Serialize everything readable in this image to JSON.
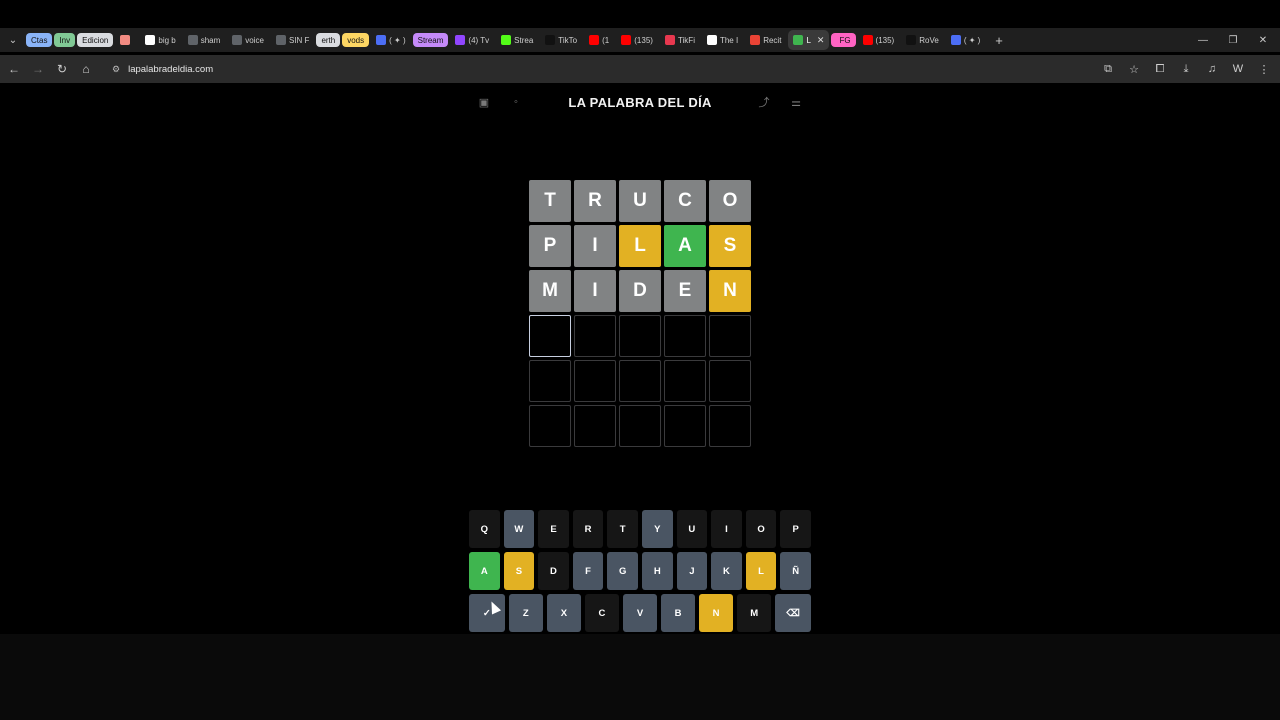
{
  "browser": {
    "tab_groups": [
      {
        "label": "Ctas",
        "color": "#8ab4f8"
      },
      {
        "label": "Inv",
        "color": "#81c995"
      },
      {
        "label": "Edicion",
        "color": "#dadce0"
      }
    ],
    "tabs": [
      {
        "label": "",
        "fav_color": "#f28b82"
      },
      {
        "label": "big b",
        "fav_color": "#ffffff"
      },
      {
        "label": "sham",
        "fav_color": "#5f6368"
      },
      {
        "label": "voice",
        "fav_color": "#5f6368"
      },
      {
        "label": "SIN F",
        "fav_color": "#5f6368"
      }
    ],
    "group2": [
      {
        "label": "erth",
        "color": "#dadce0"
      },
      {
        "label": "vods",
        "color": "#fdd663"
      }
    ],
    "tabs2": [
      {
        "label": "( ✦ )",
        "fav_color": "#4c6ef5"
      }
    ],
    "stream_group": {
      "label": "Stream",
      "color": "#c58af9"
    },
    "tabs3": [
      {
        "label": "(4) Tv",
        "fav_color": "#9146ff"
      },
      {
        "label": "Strea",
        "fav_color": "#53fc18"
      },
      {
        "label": "TikTo",
        "fav_color": "#111111"
      },
      {
        "label": "(1",
        "fav_color": "#ff0000"
      },
      {
        "label": "(135)",
        "fav_color": "#ff0000"
      },
      {
        "label": "TikFi",
        "fav_color": "#e8384f"
      },
      {
        "label": "The I",
        "fav_color": "#ffffff"
      },
      {
        "label": "Recit",
        "fav_color": "#ea4335"
      },
      {
        "label": "L",
        "fav_color": "#3fb54f",
        "active": true
      },
      {
        "label": "FG",
        "fav_color": "#ff63c3",
        "group": true
      },
      {
        "label": "(135)",
        "fav_color": "#ff0000"
      },
      {
        "label": "RoVe",
        "fav_color": "#111111"
      },
      {
        "label": "( ✦ )",
        "fav_color": "#4c6ef5"
      }
    ],
    "url": "lapalabradeldia.com"
  },
  "game": {
    "title": "LA PALABRA DEL DÍA",
    "colors": {
      "gray": "#818384",
      "yellow": "#e2b123",
      "green": "#3fb54f"
    },
    "board": [
      [
        {
          "l": "T",
          "s": "gray"
        },
        {
          "l": "R",
          "s": "gray"
        },
        {
          "l": "U",
          "s": "gray"
        },
        {
          "l": "C",
          "s": "gray"
        },
        {
          "l": "O",
          "s": "gray"
        }
      ],
      [
        {
          "l": "P",
          "s": "gray"
        },
        {
          "l": "I",
          "s": "gray"
        },
        {
          "l": "L",
          "s": "yellow"
        },
        {
          "l": "A",
          "s": "green"
        },
        {
          "l": "S",
          "s": "yellow"
        }
      ],
      [
        {
          "l": "M",
          "s": "gray"
        },
        {
          "l": "I",
          "s": "gray"
        },
        {
          "l": "D",
          "s": "gray"
        },
        {
          "l": "E",
          "s": "gray"
        },
        {
          "l": "N",
          "s": "yellow"
        }
      ],
      [
        {
          "l": "",
          "s": "active"
        },
        {
          "l": "",
          "s": "empty"
        },
        {
          "l": "",
          "s": "empty"
        },
        {
          "l": "",
          "s": "empty"
        },
        {
          "l": "",
          "s": "empty"
        }
      ],
      [
        {
          "l": "",
          "s": "empty"
        },
        {
          "l": "",
          "s": "empty"
        },
        {
          "l": "",
          "s": "empty"
        },
        {
          "l": "",
          "s": "empty"
        },
        {
          "l": "",
          "s": "empty"
        }
      ],
      [
        {
          "l": "",
          "s": "empty"
        },
        {
          "l": "",
          "s": "empty"
        },
        {
          "l": "",
          "s": "empty"
        },
        {
          "l": "",
          "s": "empty"
        },
        {
          "l": "",
          "s": "empty"
        }
      ]
    ],
    "keyboard": [
      [
        {
          "k": "Q",
          "s": "unused"
        },
        {
          "k": "W",
          "s": "used"
        },
        {
          "k": "E",
          "s": "unused"
        },
        {
          "k": "R",
          "s": "unused"
        },
        {
          "k": "T",
          "s": "unused"
        },
        {
          "k": "Y",
          "s": "used"
        },
        {
          "k": "U",
          "s": "unused"
        },
        {
          "k": "I",
          "s": "unused"
        },
        {
          "k": "O",
          "s": "unused"
        },
        {
          "k": "P",
          "s": "unused"
        }
      ],
      [
        {
          "k": "A",
          "s": "green"
        },
        {
          "k": "S",
          "s": "yellow"
        },
        {
          "k": "D",
          "s": "unused"
        },
        {
          "k": "F",
          "s": "used"
        },
        {
          "k": "G",
          "s": "used"
        },
        {
          "k": "H",
          "s": "used"
        },
        {
          "k": "J",
          "s": "used"
        },
        {
          "k": "K",
          "s": "used"
        },
        {
          "k": "L",
          "s": "yellow"
        },
        {
          "k": "Ñ",
          "s": "used"
        }
      ],
      [
        {
          "k": "✓",
          "s": "used",
          "name": "enter-key"
        },
        {
          "k": "Z",
          "s": "used"
        },
        {
          "k": "X",
          "s": "used"
        },
        {
          "k": "C",
          "s": "unused"
        },
        {
          "k": "V",
          "s": "used"
        },
        {
          "k": "B",
          "s": "used"
        },
        {
          "k": "N",
          "s": "yellow"
        },
        {
          "k": "M",
          "s": "unused"
        },
        {
          "k": "⌫",
          "s": "used",
          "name": "backspace-key"
        }
      ]
    ]
  }
}
